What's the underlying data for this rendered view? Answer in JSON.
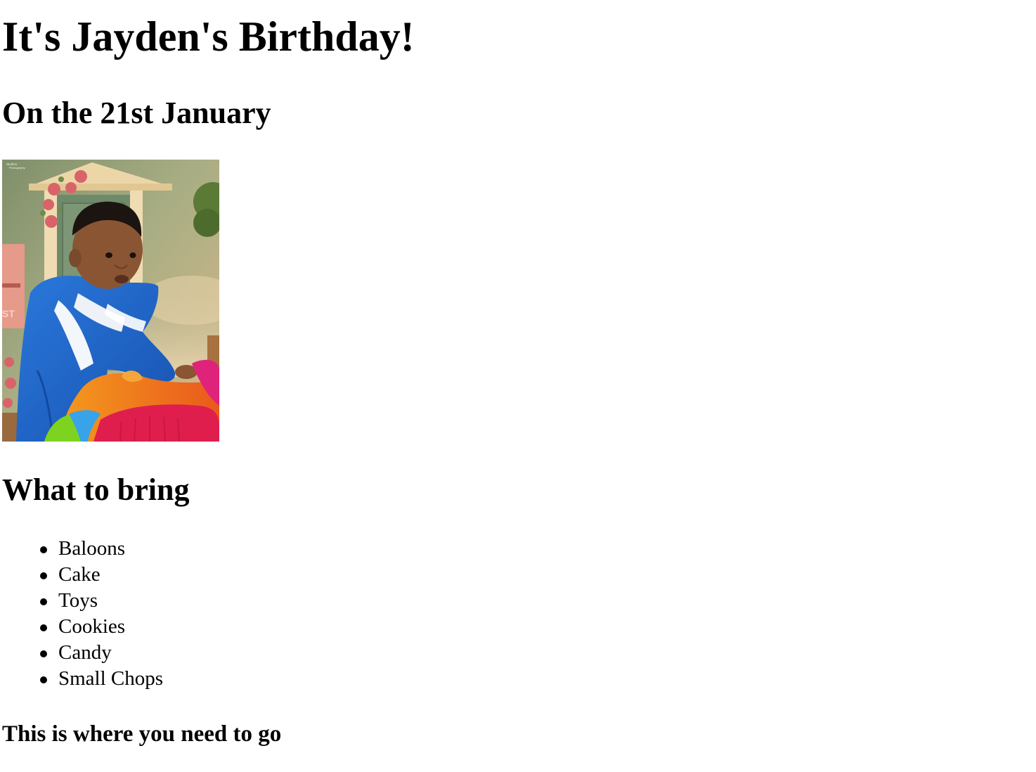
{
  "header": {
    "title": "It's Jayden's Birthday!",
    "date_line": "On the 21st January"
  },
  "photo": {
    "description_icon": "birthday-photo",
    "watermark_line1": "Studioo",
    "watermark_line2": "Photography",
    "sign_text": "ST"
  },
  "bring": {
    "heading": "What to bring",
    "items": [
      {
        "label": "Baloons"
      },
      {
        "label": "Cake"
      },
      {
        "label": "Toys"
      },
      {
        "label": "Cookies"
      },
      {
        "label": "Candy"
      },
      {
        "label": "Small Chops"
      }
    ]
  },
  "location": {
    "heading": "This is where you need to go"
  },
  "colors": {
    "background": "#ffffff",
    "text": "#000000",
    "jacket_blue": "#1f66c9",
    "toy_orange": "#f07a1c",
    "toy_magenta": "#e0237a",
    "wall_green": "#9aa77a",
    "door_cream": "#e9d2a4",
    "rose_pink": "#d8646a"
  }
}
